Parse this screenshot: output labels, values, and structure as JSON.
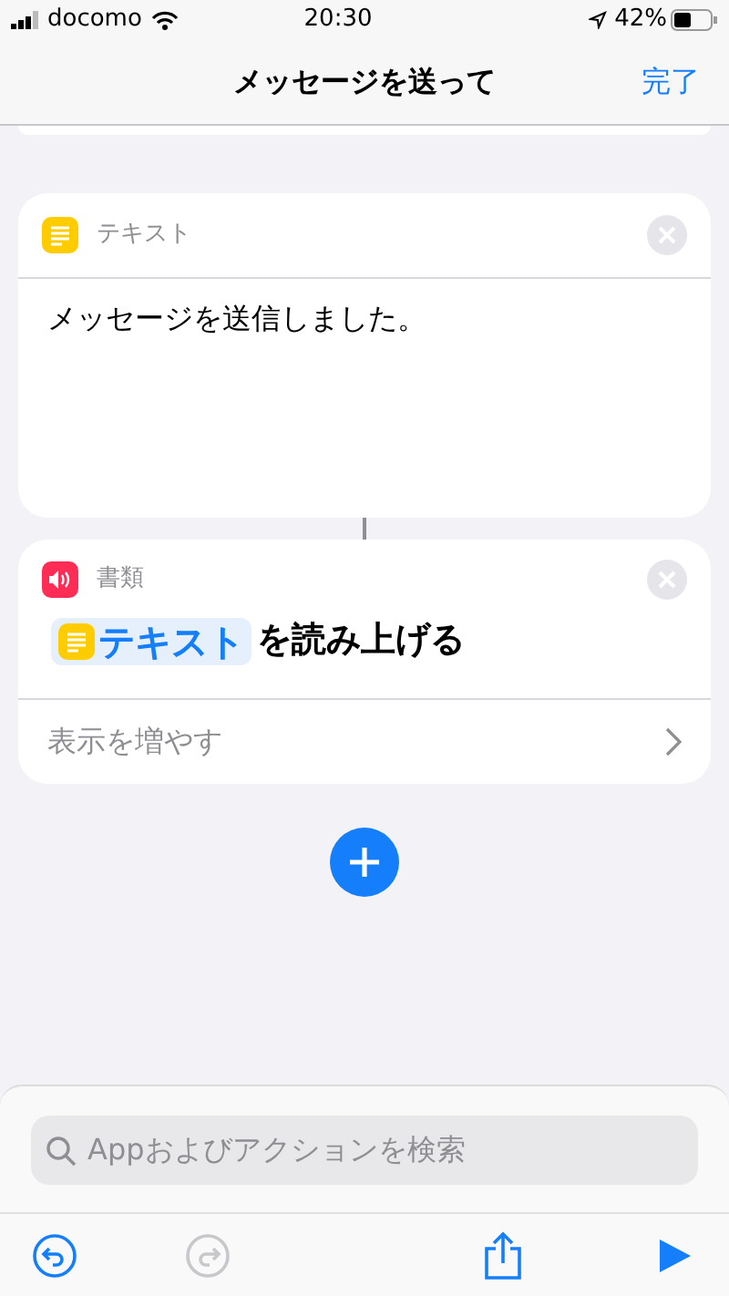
{
  "status_bar": {
    "carrier": "docomo",
    "time": "20:30",
    "battery": "42%"
  },
  "nav": {
    "title": "メッセージを送って",
    "done": "完了"
  },
  "actions": [
    {
      "kind": "text",
      "category": "テキスト",
      "body": "メッセージを送信しました。"
    },
    {
      "kind": "speak",
      "category": "書類",
      "variable": "テキスト",
      "phrase": "を読み上げる",
      "more": "表示を増やす"
    }
  ],
  "search": {
    "placeholder": "Appおよびアクションを検索"
  },
  "toolbar": [
    {
      "kind": "undo",
      "disabled": false
    },
    {
      "kind": "redo",
      "disabled": true
    },
    {
      "kind": "share",
      "disabled": false
    },
    {
      "kind": "run",
      "disabled": false
    }
  ]
}
